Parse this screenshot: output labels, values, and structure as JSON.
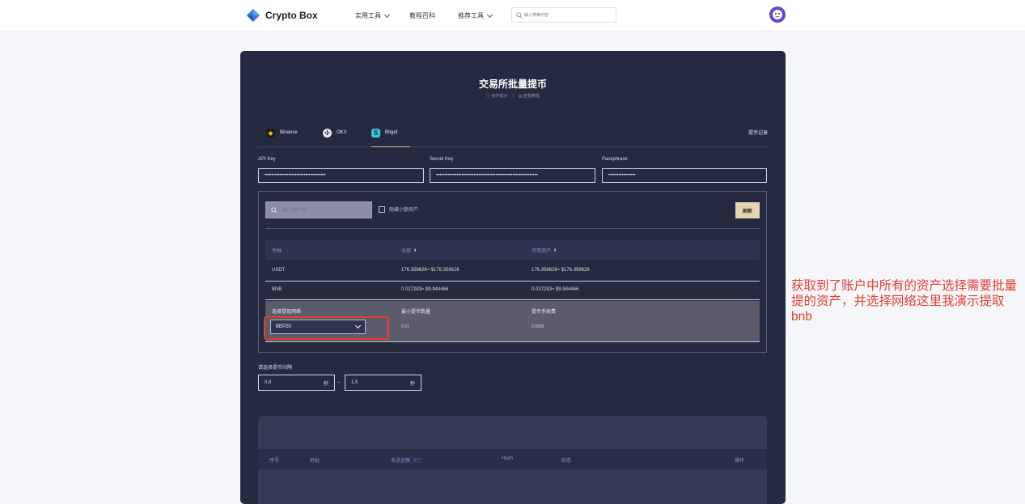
{
  "header": {
    "brand": "Crypto Box",
    "nav": [
      "实用工具",
      "教程百科",
      "推荐工具"
    ],
    "search_placeholder": "输入搜索内容"
  },
  "card": {
    "title": "交易所批量提币",
    "hint_ops": "操作提示",
    "hint_sep": "|",
    "hint_tutorial": "查看教程"
  },
  "tabs": [
    {
      "label": "Binance",
      "icon": "binance-icon"
    },
    {
      "label": "OKX",
      "icon": "okx-icon"
    },
    {
      "label": "Bitget",
      "icon": "bitget-icon",
      "active": true
    }
  ],
  "history_link": "提币记录",
  "keys": {
    "api_key_label": "API Key",
    "api_key_value": "••••••••••••••••••••••••••••••••••••",
    "secret_label": "Secret Key",
    "secret_value": "••••••••••••••••••••••••••••••••••••••••••••••••••••••••••••",
    "pass_label": "Passphrase",
    "pass_value": "••••••••••••••••"
  },
  "assets": {
    "search_placeholder": "输入搜索内容",
    "hide_small": "隐藏小额资产",
    "refresh": "刷新",
    "columns": [
      "币种",
      "全部",
      "可用资产"
    ],
    "rows": [
      {
        "coin": "USDT",
        "total": "176.358626≈ $176.358626",
        "available": "176.358626≈ $176.358626"
      },
      {
        "coin": "BNB",
        "total": "0.017283≈ $9.944466",
        "available": "0.017283≈ $9.944466"
      }
    ],
    "network": {
      "select_label": "选择提现网络",
      "min_label": "最小提币数量",
      "fee_label": "提币手续费",
      "selected": "BEP20",
      "min_value": "0.01",
      "fee_value": "0.0005"
    }
  },
  "interval": {
    "label": "请选择提币间隔",
    "from": "0.8",
    "to": "1.5",
    "unit": "秒",
    "dash": "–"
  },
  "records": {
    "columns": [
      "序号",
      "地址",
      "发送金额",
      "Hash",
      "状态",
      "操作"
    ],
    "amount_sub": "清空"
  },
  "annotation": "获取到了账户中所有的资产选择需要批量提的资产，并选择网络这里我演示提取bnb",
  "colors": {
    "card_bg": "#262a40",
    "accent_gold": "#e6d3b1",
    "highlight_red": "#e23f33"
  }
}
